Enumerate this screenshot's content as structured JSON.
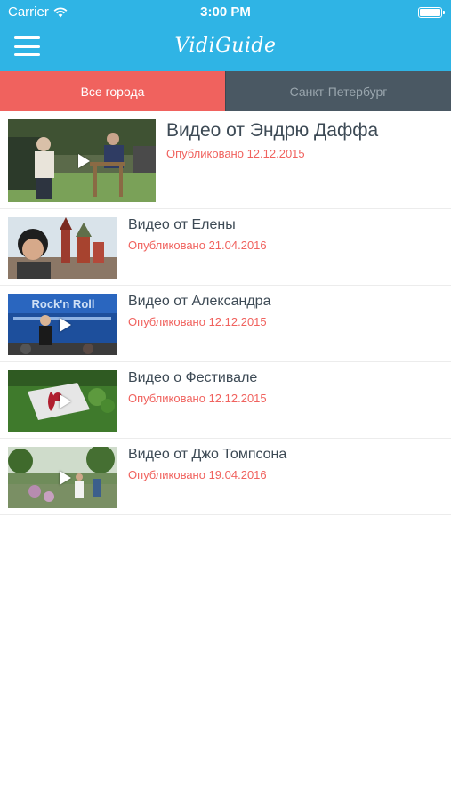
{
  "status_bar": {
    "carrier": "Carrier",
    "time": "3:00 PM",
    "wifi_icon": "wifi-icon",
    "battery_icon": "battery-icon"
  },
  "nav": {
    "title": "VidiGuide",
    "menu_icon": "hamburger-menu-icon"
  },
  "tabs": [
    {
      "label": "Все города",
      "active": true
    },
    {
      "label": "Санкт-Петербург",
      "active": false
    }
  ],
  "videos": [
    {
      "title": "Видео от Эндрю Даффа",
      "date": "Опубликовано 12.12.2015"
    },
    {
      "title": "Видео от Елены",
      "date": "Опубликовано 21.04.2016"
    },
    {
      "title": "Видео от Александра",
      "date": "Опубликовано 12.12.2015"
    },
    {
      "title": "Видео о Фестивале",
      "date": "Опубликовано 12.12.2015"
    },
    {
      "title": "Видео от Джо Томпсона",
      "date": "Опубликовано 19.04.2016"
    }
  ],
  "colors": {
    "header": "#2fb4e5",
    "accent": "#f0625e",
    "tab_inactive": "#4a5863",
    "title_text": "#3d4a55"
  }
}
